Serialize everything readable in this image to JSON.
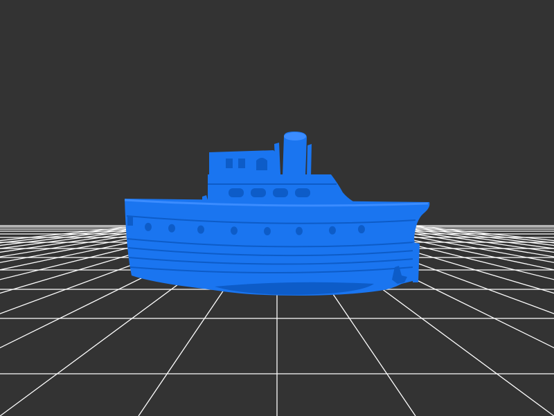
{
  "viewport": {
    "background": "#333333",
    "grid_color": "#ffffff",
    "model_color": "#1a75f0",
    "model_shade": "#0d5cc8",
    "model_highlight": "#3b8cff",
    "model": "boat-3d-model",
    "grid": "ground-plane-grid"
  }
}
